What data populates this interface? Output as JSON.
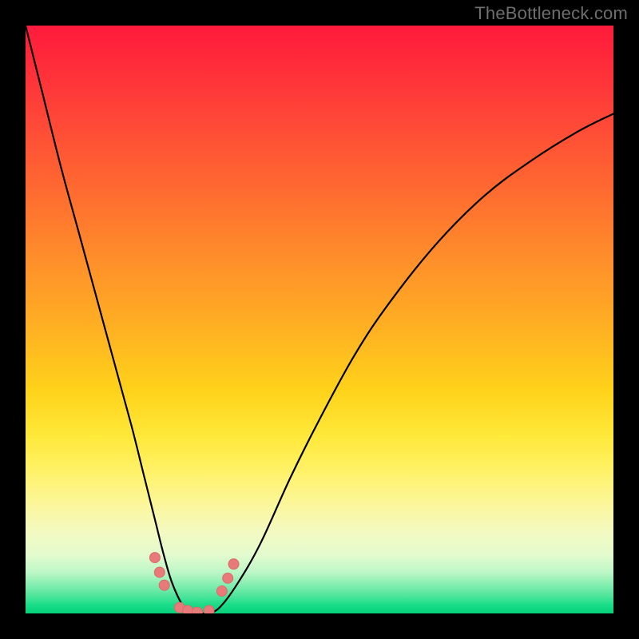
{
  "watermark": "TheBottleneck.com",
  "chart_data": {
    "type": "line",
    "title": "",
    "xlabel": "",
    "ylabel": "",
    "xlim": [
      0,
      100
    ],
    "ylim": [
      0,
      100
    ],
    "grid": false,
    "legend": false,
    "series": [
      {
        "name": "main-curve",
        "style": "solid",
        "color": "#000000",
        "x": [
          0,
          3,
          6,
          9,
          12,
          15,
          18,
          20,
          22,
          23.5,
          25,
          27,
          29,
          30,
          31,
          33,
          36,
          40,
          45,
          50,
          56,
          62,
          70,
          78,
          86,
          94,
          100
        ],
        "y": [
          100,
          88,
          76,
          65,
          54,
          43,
          32,
          24,
          16,
          10,
          5,
          1,
          0,
          0,
          0,
          1,
          5,
          12,
          23,
          33,
          44,
          53,
          63,
          71,
          77,
          82,
          85
        ]
      }
    ],
    "markers": [
      {
        "name": "pt-left-upper",
        "x": 22.0,
        "y": 9.5
      },
      {
        "name": "pt-left-mid",
        "x": 22.8,
        "y": 7.0
      },
      {
        "name": "pt-left-lower",
        "x": 23.6,
        "y": 4.8
      },
      {
        "name": "pt-bottom-1",
        "x": 26.2,
        "y": 1.0
      },
      {
        "name": "pt-bottom-2",
        "x": 27.6,
        "y": 0.5
      },
      {
        "name": "pt-bottom-3",
        "x": 29.2,
        "y": 0.2
      },
      {
        "name": "pt-bottom-4",
        "x": 31.2,
        "y": 0.5
      },
      {
        "name": "pt-right-lower",
        "x": 33.4,
        "y": 3.8
      },
      {
        "name": "pt-right-mid",
        "x": 34.4,
        "y": 6.0
      },
      {
        "name": "pt-right-upper",
        "x": 35.4,
        "y": 8.4
      }
    ],
    "marker_style": {
      "size": 6.5,
      "fill": "#e97a7a"
    }
  }
}
